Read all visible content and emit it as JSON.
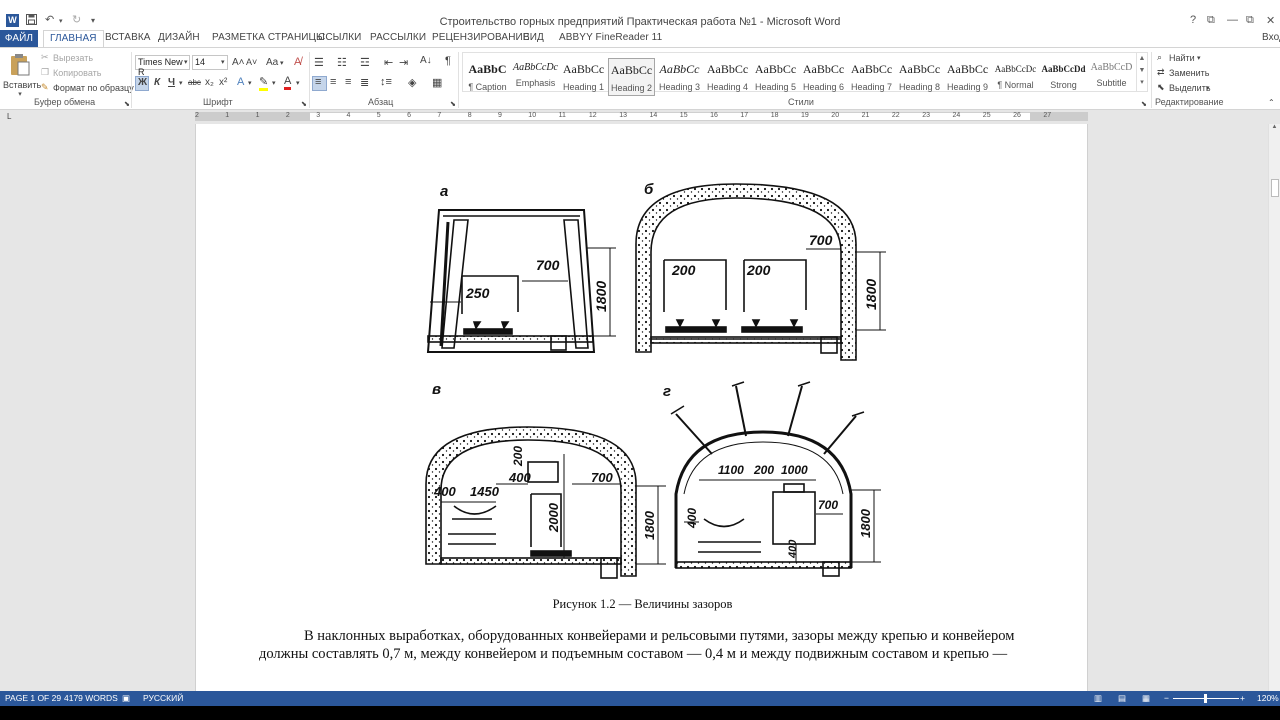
{
  "window": {
    "title": "Строительство горных предприятий Практическая работа №1 - Microsoft Word",
    "app_icon": "W",
    "controls": {
      "help": "?",
      "restore": "⧉",
      "minimize": "—",
      "maximize": "☐",
      "close": "✕"
    },
    "signin": "Вход"
  },
  "quick_access": {
    "save_icon": "save-icon",
    "undo_icon": "undo-icon",
    "redo_icon": "redo-icon",
    "customize_icon": "▾"
  },
  "tabs": [
    {
      "label": "ФАЙЛ"
    },
    {
      "label": "ГЛАВНАЯ"
    },
    {
      "label": "ВСТАВКА"
    },
    {
      "label": "ДИЗАЙН"
    },
    {
      "label": "РАЗМЕТКА СТРАНИЦЫ"
    },
    {
      "label": "ССЫЛКИ"
    },
    {
      "label": "РАССЫЛКИ"
    },
    {
      "label": "РЕЦЕНЗИРОВАНИЕ"
    },
    {
      "label": "ВИД"
    },
    {
      "label": "ABBYY FineReader 11"
    }
  ],
  "active_tab": "ГЛАВНАЯ",
  "clipboard": {
    "paste": "Вставить",
    "cut": "Вырезать",
    "copy": "Копировать",
    "format_painter": "Формат по образцу",
    "group": "Буфер обмена"
  },
  "font": {
    "family": "Times New R",
    "size": "14",
    "grow": "A˄",
    "shrink": "A˅",
    "case": "Aa",
    "bold": "Ж",
    "italic": "К",
    "underline": "Ч",
    "strike": "abc",
    "subscript": "x₂",
    "superscript": "x²",
    "group": "Шрифт"
  },
  "paragraph": {
    "group": "Абзац"
  },
  "styles": {
    "group": "Стили",
    "items": [
      {
        "preview": "AaBbC",
        "name": "¶ Caption"
      },
      {
        "preview": "AaBbCcDc",
        "name": "Emphasis"
      },
      {
        "preview": "AaBbCс",
        "name": "Heading 1"
      },
      {
        "preview": "AaBbCс",
        "name": "Heading 2"
      },
      {
        "preview": "AaBbCс",
        "name": "Heading 3"
      },
      {
        "preview": "AaBbCс",
        "name": "Heading 4"
      },
      {
        "preview": "AaBbCс",
        "name": "Heading 5"
      },
      {
        "preview": "AaBbCс",
        "name": "Heading 6"
      },
      {
        "preview": "AaBbCс",
        "name": "Heading 7"
      },
      {
        "preview": "AaBbCс",
        "name": "Heading 8"
      },
      {
        "preview": "AaBbCс",
        "name": "Heading 9"
      },
      {
        "preview": "AaBbCcDc",
        "name": "¶ Normal"
      },
      {
        "preview": "AaBbCcDd",
        "name": "Strong"
      },
      {
        "preview": "AaBbCcD",
        "name": "Subtitle"
      }
    ],
    "selected_index": 3
  },
  "editing": {
    "find": "Найти",
    "replace": "Заменить",
    "select": "Выделить",
    "group": "Редактирование"
  },
  "ruler": {
    "numbers": [
      "2",
      "1",
      "1",
      "2",
      "3",
      "4",
      "5",
      "6",
      "7",
      "8",
      "9",
      "10",
      "11",
      "12",
      "13",
      "14",
      "15",
      "16",
      "17",
      "18",
      "19",
      "20",
      "21",
      "22",
      "23",
      "24",
      "25",
      "26",
      "27"
    ],
    "corner": "L"
  },
  "figure": {
    "panels": {
      "a": "а",
      "b": "б",
      "v": "в",
      "g": "г"
    },
    "dims": {
      "a_700": "700",
      "a_250": "250",
      "a_1800": "1800",
      "b_700": "700",
      "b_200_left": "200",
      "b_200_right": "200",
      "b_1800": "1800",
      "v_200": "200",
      "v_400_left": "400",
      "v_1450": "1450",
      "v_400_mid": "400",
      "v_700": "700",
      "v_2000": "2000",
      "v_1800": "1800",
      "g_1100": "1100",
      "g_200": "200",
      "g_1000": "1000",
      "g_400_left": "400",
      "g_700": "700",
      "g_400_bottom": "400",
      "g_1800": "1800"
    }
  },
  "document": {
    "caption": "Рисунок 1.2 — Величины зазоров",
    "para_line1": "В наклонных выработках, оборудованных конвейерами и рельсовыми путями, зазоры между крепью и конвейером",
    "para_line2": "должны составлять 0,7 м, между конвейером и подъемным составом — 0,4 м и между подвижным составом и крепью  —"
  },
  "status": {
    "page": "PAGE 1 OF 29",
    "words": "4179 WORDS",
    "language": "РУССКИЙ",
    "zoom": "120%",
    "zoom_minus": "−",
    "zoom_plus": "+"
  },
  "colors": {
    "accent": "#2b579a",
    "workspace": "#e6e6e6",
    "text": "#111111"
  }
}
